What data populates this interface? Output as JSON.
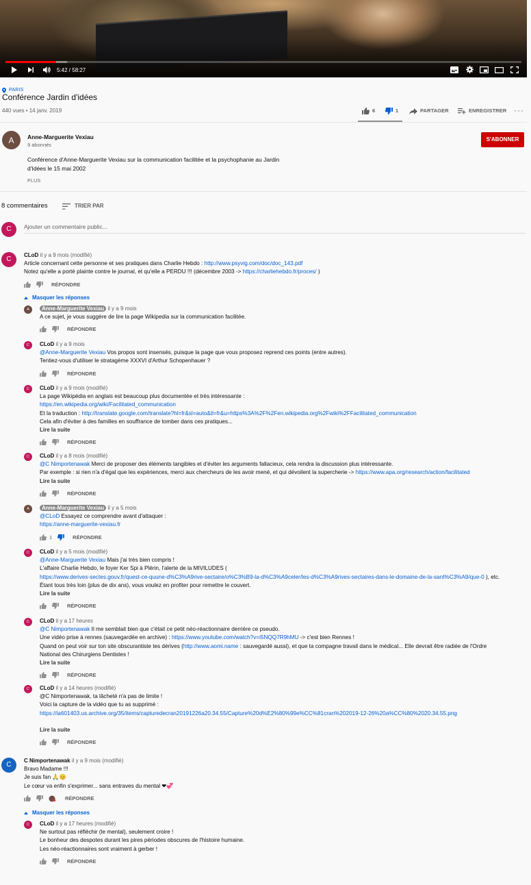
{
  "player": {
    "time": "5:42 / 58:27",
    "progress_fraction": 0.098,
    "loaded_fraction": 0.12
  },
  "video": {
    "location": "PARIS",
    "title": "Conférence Jardin d'idées",
    "views_date": "440 vues • 14 janv. 2019",
    "likes": "6",
    "dislikes": "1",
    "share_label": "PARTAGER",
    "save_label": "ENREGISTRER"
  },
  "channel": {
    "avatar_letter": "A",
    "avatar_color": "#6d4c41",
    "name": "Anne-Marguerite Vexiau",
    "subscribers": "9 abonnés",
    "subscribe_label": "S'ABONNER",
    "description_lines": [
      "Conférence d'Anne-Marguerite Vexiau sur la communication facilitée et la psychophanie au Jardin",
      "d'Idées le 15 mai 2002"
    ],
    "more_label": "PLUS"
  },
  "comments_section": {
    "count_label": "8 commentaires",
    "sort_label": "TRIER PAR",
    "add_placeholder": "Ajouter un commentaire public...",
    "user_avatar_letter": "C",
    "user_avatar_color": "#c2185b",
    "reply_label": "RÉPONDRE",
    "read_more_label": "Lire la suite",
    "hide_replies_label": "Masquer les réponses"
  },
  "comments": [
    {
      "author": "CLoD",
      "time": "il y a 9 mois (modifié)",
      "avatar_letter": "C",
      "avatar_color": "#c2185b",
      "lines": [
        [
          "Article concernant cette personne et ses pratiques dans Charlie Hebdo : ",
          "http://www.psyvig.com/doc/doc_143.pdf"
        ],
        [
          "Notez qu'elle a porté plainte contre le journal, et qu'elle a PERDU !!! (décembre 2003 -> ",
          "https://charliehebdo.fr/proces/",
          " )"
        ]
      ]
    },
    {
      "author": "C Nimportenawak",
      "time": "il y a 9 mois (modifié)",
      "avatar_letter": "C",
      "avatar_color": "#1565c0",
      "lines": [
        [
          "Bravo Madame !!!"
        ],
        [
          "Je suis fan 🙏😊"
        ],
        [
          "Le cœur va enfin s'exprimer... sans entraves du mental ❤💞"
        ]
      ]
    }
  ],
  "replies": [
    {
      "author": "Anne-Marguerite Vexiau",
      "owner": true,
      "time": "il y a 9 mois",
      "avatar_letter": "A",
      "avatar_color": "#6d4c41",
      "lines": [
        [
          "A ce sujet, je vous suggère de lire la page Wikipedia sur la communication facilitée."
        ]
      ]
    },
    {
      "author": "CLoD",
      "owner": false,
      "time": "il y a 9 mois",
      "avatar_letter": "C",
      "avatar_color": "#c2185b",
      "lines": [
        [
          "",
          "@Anne-Marguerite Vexiau",
          "  Vos propos sont insensés, puisque la page que vous proposez reprend ces points (entre autres)."
        ],
        [
          "Tentiez-vous d'utiliser le stratagème XXXVI d'Arthur Schopenhauer ?"
        ]
      ]
    },
    {
      "author": "CLoD",
      "owner": false,
      "time": "il y a 9 mois (modifié)",
      "avatar_letter": "C",
      "avatar_color": "#c2185b",
      "lines": [
        [
          "La page Wikipédia en anglais est beaucoup plus documentée et très intéressante :"
        ],
        [
          "",
          "https://en.wikipedia.org/wiki/Facilitated_communication"
        ],
        [
          "Et la traduction : ",
          "http://translate.google.com/translate?hl=fr&sl=auto&tl=fr&u=https%3A%2F%2Fen.wikipedia.org%2Fwiki%2FFacilitated_communication"
        ],
        [
          "Cela afin d'éviter à des familles en souffrance de tomber dans ces pratiques..."
        ]
      ],
      "read_more": true
    },
    {
      "author": "CLoD",
      "owner": false,
      "time": "il y a 8 mois (modifié)",
      "avatar_letter": "C",
      "avatar_color": "#c2185b",
      "lines": [
        [
          "",
          "@C Nimportenawak",
          " Merci de proposer des éléments tangibles et d'éviter les arguments fallacieux, cela rendra la discussion plus intéressante."
        ],
        [
          "Par exemple : si rien n'a d'égal que les expériences, merci aux chercheurs de les avoir mené, et qui dévoilent la supercherie -> ",
          "https://www.apa.org/research/action/facilitated"
        ]
      ],
      "read_more": true
    },
    {
      "author": "Anne-Marguerite Vexiau",
      "owner": true,
      "time": "il y a 5 mois",
      "avatar_letter": "A",
      "avatar_color": "#6d4c41",
      "lines": [
        [
          "",
          "@CLoD",
          " Essayez ce comprendre avant d'attaquer :"
        ],
        [
          "",
          "https://anne-marguerite-vexiau.fr"
        ]
      ],
      "likes": "1",
      "disliked": true
    },
    {
      "author": "CLoD",
      "owner": false,
      "time": "il y a 5 mois (modifié)",
      "avatar_letter": "C",
      "avatar_color": "#c2185b",
      "lines": [
        [
          "",
          "@Anne-Marguerite Vexiau",
          " Mais j'ai très bien compris !"
        ],
        [
          "L'affaire Charlie Hebdo, le foyer Ker Spi à Plérin, l'alerte de la MIVILUDES ("
        ],
        [
          "",
          "https://www.derives-sectes.gouv.fr/quest-ce-quune-d%C3%A9rive-sectaire/o%C3%B9-la-d%C3%A9celer/les-d%C3%A9rives-sectaires-dans-le-domaine-de-la-sant%C3%A9/que-0",
          " ), etc."
        ],
        [
          "Étant tous très loin (plus de dix ans), vous voulez en profiter pour remettre le couvert."
        ]
      ],
      "read_more": true
    },
    {
      "author": "CLoD",
      "owner": false,
      "time": "il y a 17 heures",
      "avatar_letter": "C",
      "avatar_color": "#c2185b",
      "lines": [
        [
          "",
          "@C Nimportenawak",
          " Il me semblait bien que c'était ce petit néo-réactionnaire derrière ce pseudo."
        ],
        [
          "Une vidéo prise à rennes (sauvegardée en archive) : ",
          "https://www.youtube.com/watch?v=i5NQQ7R9hMU",
          " -> c'est bien Rennes !"
        ],
        [
          "Quand on peut voir sur ton site obscurantiste tes dérives (",
          "http://www.aomi.name",
          "  : sauvegardé aussi), et que ta compagne travail dans le médical... Elle devrait être radiée de l'Ordre"
        ],
        [
          "National des Chirurgiens Dentistes !"
        ]
      ],
      "read_more": true
    },
    {
      "author": "CLoD",
      "owner": false,
      "time": "il y a 14 heures (modifié)",
      "avatar_letter": "C",
      "avatar_color": "#c2185b",
      "lines": [
        [
          "@C Nimportenawak, ta lâcheté n'a pas de limite !"
        ],
        [
          " "
        ],
        [
          "Voici la capture de la vidéo que tu as supprimé :"
        ],
        [
          "",
          "https://ia601403.us.archive.org/35/items/capturedecran20191226a20.34.55/Capture%20d%E2%80%99e%CC%81cran%202019-12-26%20a%CC%80%2020.34.55.png"
        ]
      ],
      "read_more": true
    },
    {
      "author": "CLoD",
      "owner": false,
      "time": "il y a 17 heures (modifié)",
      "avatar_letter": "C",
      "avatar_color": "#c2185b",
      "lines": [
        [
          "Ne surtout pas réfléchir (le mental), seulement croire !"
        ],
        [
          "Le bonheur des despotes durant les pires périodes obscures de l'histoire humaine."
        ],
        [
          "Les néo-réactionnaires sont vraiment à gerber !"
        ]
      ]
    }
  ]
}
